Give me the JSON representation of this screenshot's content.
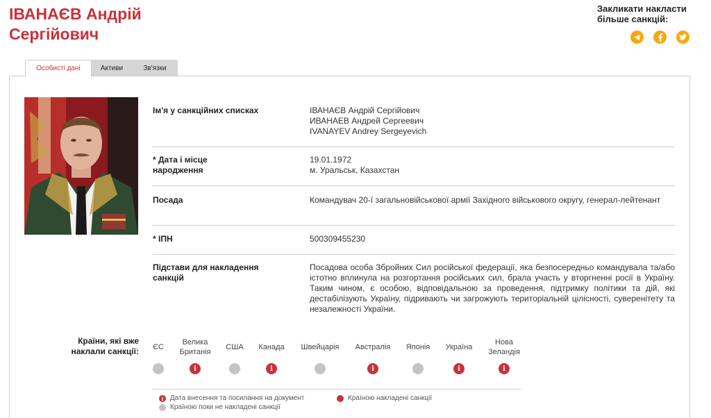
{
  "person": {
    "name": "ІВАНАЄВ Андрій Сергійович"
  },
  "cta": {
    "text": "Закликати накласти більше санкцій:",
    "social": [
      "telegram-icon",
      "facebook-icon",
      "twitter-icon"
    ],
    "accent_color": "#f6a80c"
  },
  "tabs": [
    {
      "label": "Особисті дані",
      "active": true
    },
    {
      "label": "Активи",
      "active": false
    },
    {
      "label": "Зв'язки",
      "active": false
    }
  ],
  "details": {
    "names": {
      "label": "Ім'я у санкційних списках",
      "lines": [
        "ІВАНАЄВ Андрій Сергійович",
        "ИВАНАЕВ Андрей Сергеевич",
        "IVANAYEV Andrey Sergeyevich"
      ]
    },
    "birth": {
      "label": "* Дата і місце народження",
      "lines": [
        "19.01.1972",
        "м. Уральськ, Казахстан"
      ]
    },
    "position": {
      "label": "Посада",
      "value": "Командувач 20-ї загальновійськової армії Західного військового округу, генерал-лейтенант"
    },
    "ipn": {
      "label": "* ІПН",
      "value": "500309455230"
    },
    "grounds": {
      "label": "Підстави для накладення санкцій",
      "value": "Посадова особа Збройних Сил російської федерації, яка безпосередньо командувала та/або істотно вплинула на розгортання російських сил, брала участь у вторгненні росії в Україну. Таким чином, є особою, відповідальною за проведення, підтримку політики та дій, які дестабілізують Україну, підривають чи загрожують територіальній цілісності, суверенітету та незалежності України."
    }
  },
  "sanctions": {
    "label": "Країни, які вже наклали санкції:",
    "countries": [
      {
        "name": "ЄС",
        "status": "not_imposed"
      },
      {
        "name": "Велика Британія",
        "status": "imposed"
      },
      {
        "name": "США",
        "status": "not_imposed"
      },
      {
        "name": "Канада",
        "status": "imposed"
      },
      {
        "name": "Швейцарія",
        "status": "not_imposed"
      },
      {
        "name": "Австралія",
        "status": "imposed"
      },
      {
        "name": "Японія",
        "status": "not_imposed"
      },
      {
        "name": "Україна",
        "status": "imposed"
      },
      {
        "name": "Нова Зеландія",
        "status": "imposed"
      }
    ],
    "legend": {
      "info": "Дата внесення та посилання на документ",
      "imposed": "Країною накладені санкції",
      "not_imposed": "Країною поки не накладені санкції"
    },
    "colors": {
      "imposed": "#c8323a",
      "not_imposed": "#c4c4c4"
    }
  }
}
